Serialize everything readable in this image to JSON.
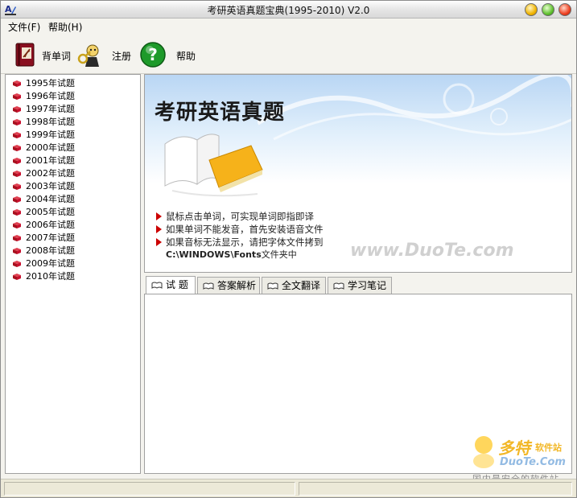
{
  "window": {
    "title": "考研英语真题宝典(1995-2010) V2.0"
  },
  "menu": {
    "items": [
      {
        "label": "文件(F)"
      },
      {
        "label": "帮助(H)"
      }
    ]
  },
  "toolbar": {
    "items": [
      {
        "label": "背单词",
        "icon": "vocabulary-book-icon"
      },
      {
        "label": "注册",
        "icon": "register-key-icon"
      },
      {
        "label": "帮助",
        "icon": "help-question-icon"
      }
    ]
  },
  "tree": {
    "items": [
      {
        "label": "1995年试题"
      },
      {
        "label": "1996年试题"
      },
      {
        "label": "1997年试题"
      },
      {
        "label": "1998年试题"
      },
      {
        "label": "1999年试题"
      },
      {
        "label": "2000年试题"
      },
      {
        "label": "2001年试题"
      },
      {
        "label": "2002年试题"
      },
      {
        "label": "2003年试题"
      },
      {
        "label": "2004年试题"
      },
      {
        "label": "2005年试题"
      },
      {
        "label": "2006年试题"
      },
      {
        "label": "2007年试题"
      },
      {
        "label": "2008年试题"
      },
      {
        "label": "2009年试题"
      },
      {
        "label": "2010年试题"
      }
    ]
  },
  "banner": {
    "title": "考研英语真题",
    "lines": [
      "鼠标点击单词，可实现单词即指即译",
      "如果单词不能发音，首先安装语音文件",
      "如果音标无法显示，请把字体文件拷到"
    ],
    "path": "C:\\WINDOWS\\Fonts",
    "path_suffix": "文件夹中",
    "watermark": "www.DuoTe.com"
  },
  "tabs": [
    {
      "label": "试 题",
      "active": true
    },
    {
      "label": "答案解析",
      "active": false
    },
    {
      "label": "全文翻译",
      "active": false
    },
    {
      "label": "学习笔记",
      "active": false
    }
  ],
  "watermark": {
    "brand": "多特",
    "sub": "软件站",
    "domain": "DuoTe.Com",
    "slogan": "国内最安全的软件站"
  },
  "colors": {
    "arrow": "#cc0000",
    "book": "#c8102e",
    "help": "#1e9a2a"
  }
}
